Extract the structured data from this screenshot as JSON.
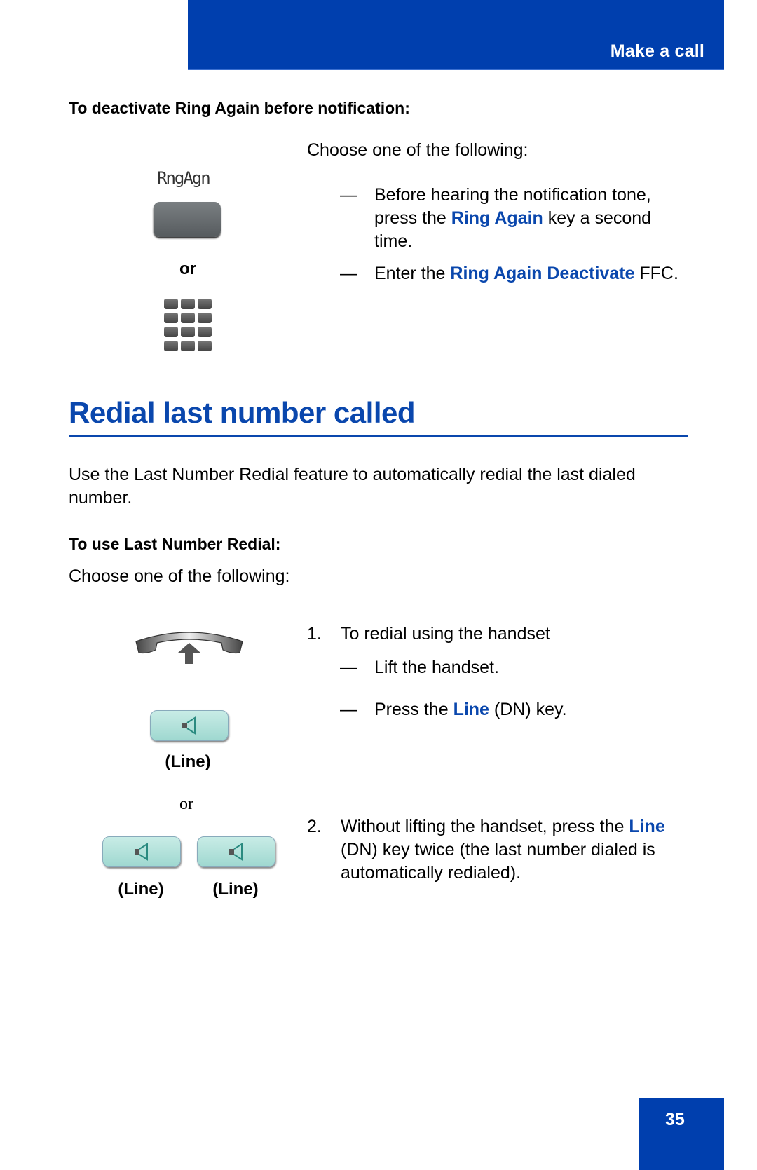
{
  "header": {
    "title": "Make a call",
    "color": "#003fae"
  },
  "deactivate": {
    "heading": "To deactivate Ring Again before notification:",
    "softkey_label": "RngAgn",
    "or_label": "or",
    "intro": "Choose one of the following:",
    "options": [
      {
        "before": "Before hearing the notification tone, press the ",
        "highlight": "Ring Again",
        "after": " key a second time."
      },
      {
        "before": "Enter the ",
        "highlight": "Ring Again Deactivate",
        "after": " FFC."
      }
    ]
  },
  "section": {
    "title": "Redial last number called",
    "description": "Use the Last Number Redial feature to automatically redial the last dialed number.",
    "subheading": "To use Last Number Redial:",
    "intro": "Choose one of the following:",
    "steps": [
      {
        "number": "1.",
        "text": "To redial using the handset",
        "substeps": [
          {
            "before": "Lift the handset.",
            "highlight": "",
            "after": ""
          },
          {
            "before": "Press the ",
            "highlight": "Line",
            "after": " (DN) key."
          }
        ]
      },
      {
        "number": "2.",
        "before": "Without lifting the handset, press the ",
        "highlight": "Line",
        "after": " (DN) key twice (the last number dialed is automatically redialed)."
      }
    ],
    "icons": {
      "line_caption": "(Line)",
      "or_label": "or"
    }
  },
  "dash": "—",
  "page_number": "35",
  "accent_color": "#0a47ad"
}
